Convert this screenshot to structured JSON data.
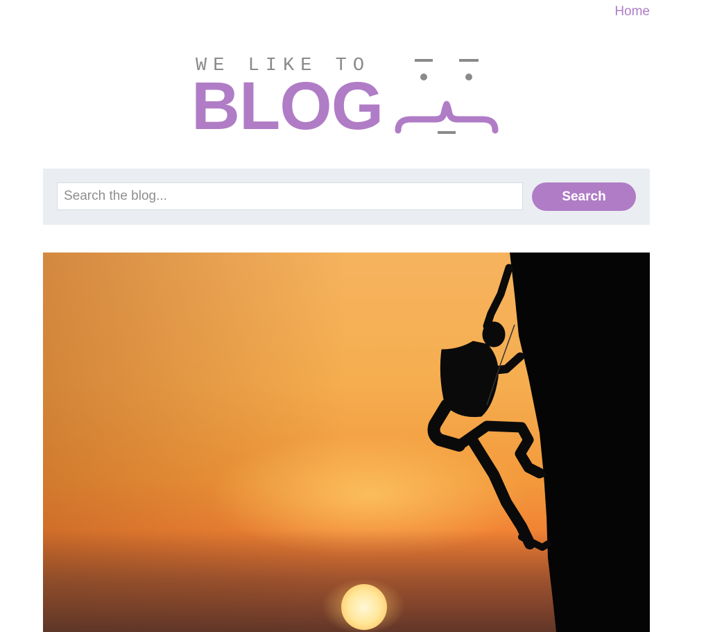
{
  "nav": {
    "home_label": "Home"
  },
  "logo": {
    "small_text": "WE LIKE TO",
    "big_text": "BLOG"
  },
  "search": {
    "placeholder": "Search the blog...",
    "value": "",
    "button_label": "Search"
  },
  "hero": {
    "image_subject": "climber-silhouette-at-sunset"
  },
  "colors": {
    "accent": "#b07cc6",
    "logo_grey": "#8a8a8a",
    "search_bg": "#eaeef2"
  }
}
